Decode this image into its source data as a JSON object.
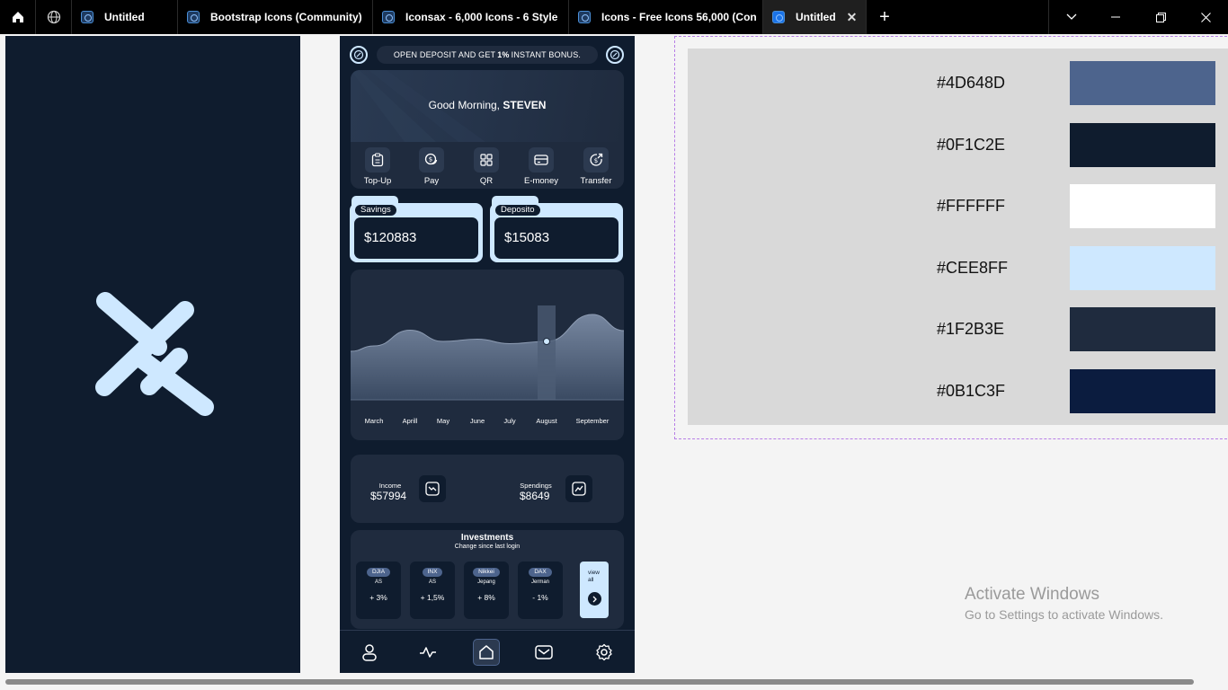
{
  "browser": {
    "tabs": [
      {
        "label": "Untitled",
        "active": false
      },
      {
        "label": "Bootstrap Icons (Community)",
        "active": false
      },
      {
        "label": "Iconsax - 6,000 Icons - 6 Style",
        "active": false
      },
      {
        "label": "Icons - Free Icons 56,000 (Con",
        "active": false
      },
      {
        "label": "Untitled",
        "active": true
      }
    ],
    "close_glyph": "✕",
    "new_tab_glyph": "+"
  },
  "app": {
    "promo": {
      "before": "OPEN DEPOSIT AND GET",
      "bold": "1%",
      "after": "INSTANT BONUS."
    },
    "greeting": {
      "prefix": "Good Morning,",
      "name": "STEVEN"
    },
    "quick_actions": [
      {
        "label": "Top-Up",
        "icon": "clipboard-icon"
      },
      {
        "label": "Pay",
        "icon": "coins-icon"
      },
      {
        "label": "QR",
        "icon": "qr-scan-icon"
      },
      {
        "label": "E-money",
        "icon": "card-icon"
      },
      {
        "label": "Transfer",
        "icon": "money-send-icon"
      }
    ],
    "accounts": [
      {
        "label": "Savings",
        "amount": "$120883"
      },
      {
        "label": "Deposito",
        "amount": "$15083"
      }
    ],
    "income": {
      "label": "Income",
      "value": "$57994"
    },
    "spendings": {
      "label": "Spendings",
      "value": "$8649"
    },
    "investments": {
      "title": "Investments",
      "subtitle": "Change since last login",
      "stocks": [
        {
          "ticker": "DJIA",
          "exchange": "AS",
          "change": "+ 3%"
        },
        {
          "ticker": "INX",
          "exchange": "AS",
          "change": "+ 1,5%"
        },
        {
          "ticker": "Nikkei",
          "exchange": "Jepang",
          "change": "+ 8%"
        },
        {
          "ticker": "DAX",
          "exchange": "Jerman",
          "change": "- 1%"
        }
      ],
      "view_all": "view all"
    },
    "bottom_nav": [
      "profile-icon",
      "activity-icon",
      "home-icon",
      "mail-icon",
      "settings-icon"
    ],
    "active_nav": "home-icon"
  },
  "chart_data": {
    "type": "area",
    "categories": [
      "March",
      "Aprill",
      "May",
      "June",
      "July",
      "August",
      "September"
    ],
    "values": [
      48,
      62,
      52,
      54,
      50,
      52,
      76
    ],
    "highlight": "August",
    "title": "",
    "xlabel": "",
    "ylabel": "",
    "grid": false
  },
  "palette": [
    {
      "hex": "#4D648D"
    },
    {
      "hex": "#0F1C2E"
    },
    {
      "hex": "#FFFFFF"
    },
    {
      "hex": "#CEE8FF"
    },
    {
      "hex": "#1F2B3E"
    },
    {
      "hex": "#0B1C3F"
    }
  ],
  "watermark": {
    "title": "Activate Windows",
    "subtitle": "Go to Settings to activate Windows."
  },
  "colors": {
    "accent": "#CEE8FF",
    "panel": "#0F1C2E",
    "card": "#1F2B3E",
    "muted": "#4D648D"
  }
}
